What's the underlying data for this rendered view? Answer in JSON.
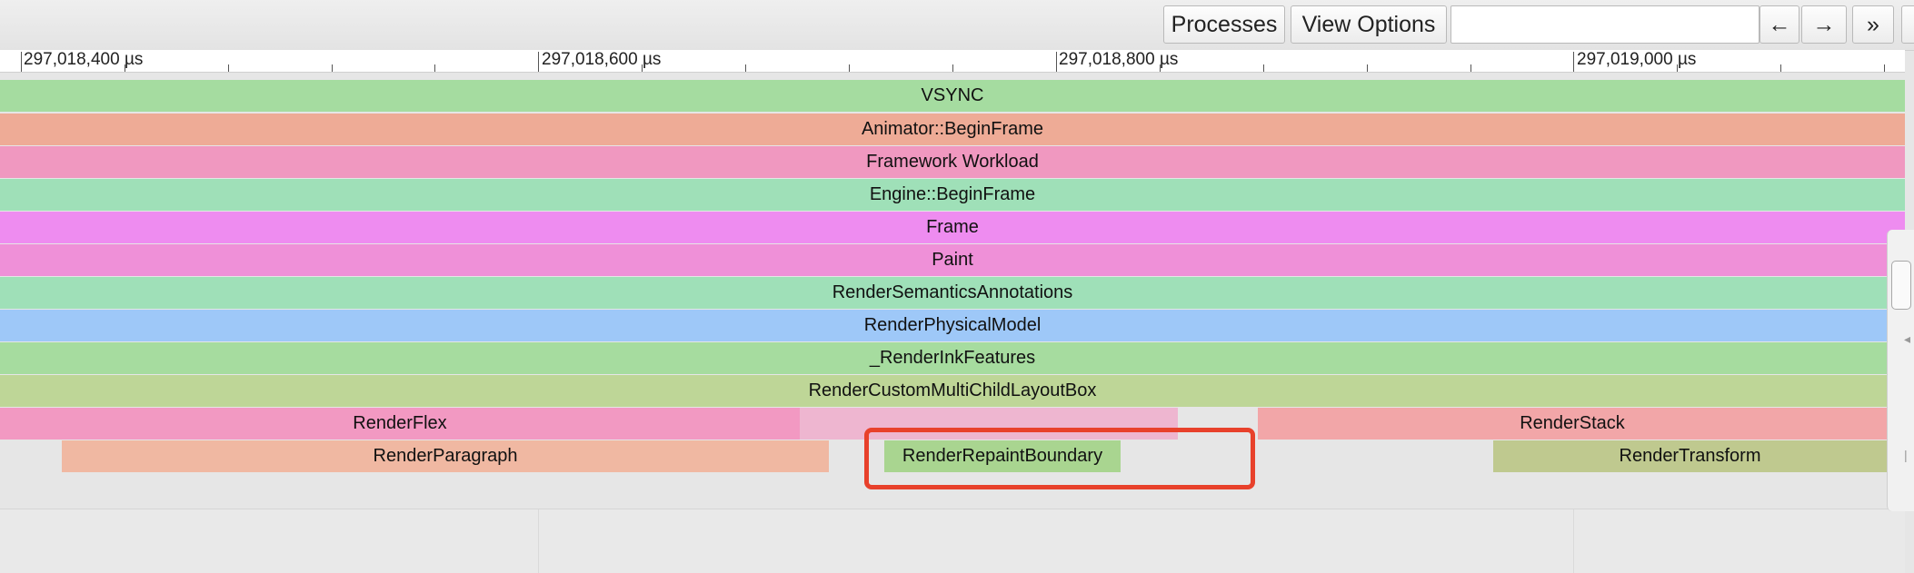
{
  "toolbar": {
    "processes_label": "Processes",
    "view_options_label": "View Options",
    "search_value": "",
    "back_label": "←",
    "forward_label": "→",
    "more_label": "»"
  },
  "ruler": {
    "labels": [
      "297,018,400 µs",
      "297,018,600 µs",
      "297,018,800 µs",
      "297,019,000 µs"
    ]
  },
  "events": {
    "vsync": "VSYNC",
    "animator_begin_frame": "Animator::BeginFrame",
    "framework_workload": "Framework Workload",
    "engine_begin_frame": "Engine::BeginFrame",
    "frame": "Frame",
    "paint": "Paint",
    "render_semantics_annotations": "RenderSemanticsAnnotations",
    "render_physical_model": "RenderPhysicalModel",
    "render_ink_features": "_RenderInkFeatures",
    "render_custom_multi_child_layout_box": "RenderCustomMultiChildLayoutBox",
    "render_flex": "RenderFlex",
    "render_stack": "RenderStack",
    "render_paragraph": "RenderParagraph",
    "render_repaint_boundary": "RenderRepaintBoundary",
    "render_transform": "RenderTransform"
  },
  "colors": {
    "vsync": "#a5dca0",
    "animator": "#eeab96",
    "framework": "#f098c0",
    "engine": "#9fe0b8",
    "frame": "#ee8cf0",
    "paint": "#ef90d8",
    "semantics": "#9fe0b8",
    "physical": "#9ec8f8",
    "ink": "#a6dc9f",
    "layout_box": "#bed697",
    "flex": "#f299c2",
    "stack": "#f2a6a8",
    "paragraph": "#f0b8a2",
    "repaint": "#a9d590",
    "transform": "#bfc98f",
    "highlight": "#e8412b"
  }
}
